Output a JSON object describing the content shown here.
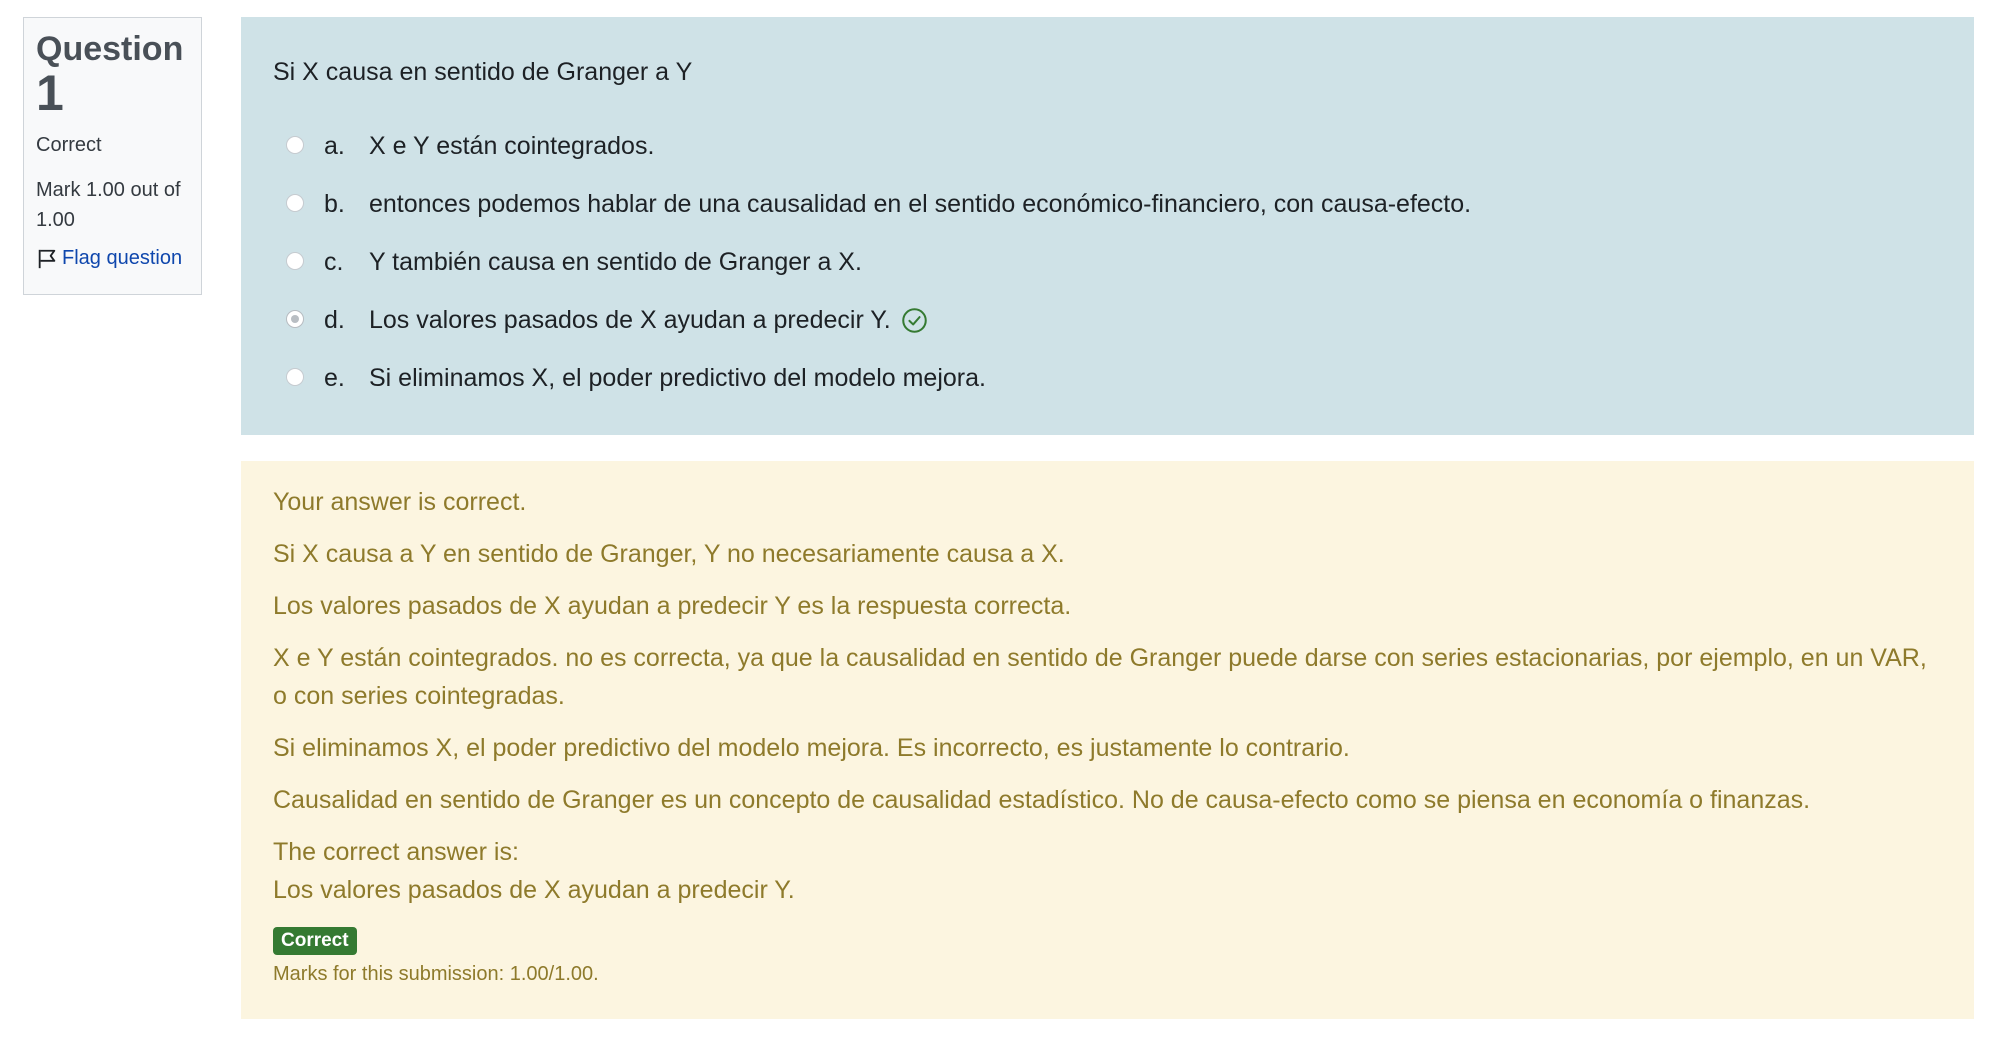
{
  "info": {
    "question_label": "Question",
    "question_number": "1",
    "state": "Correct",
    "grade": "Mark 1.00 out of 1.00",
    "flag_label": "Flag question"
  },
  "question": {
    "text": "Si X causa en sentido de Granger a Y",
    "answers": [
      {
        "letter": "a.",
        "text": "X e Y están cointegrados.",
        "selected": false
      },
      {
        "letter": "b.",
        "text": "entonces podemos hablar de una causalidad en el sentido económico-financiero, con causa-efecto.",
        "selected": false
      },
      {
        "letter": "c.",
        "text": "Y también causa en sentido de Granger a X.",
        "selected": false
      },
      {
        "letter": "d.",
        "text": "Los valores pasados de X ayudan a predecir Y.",
        "selected": true
      },
      {
        "letter": "e.",
        "text": "Si eliminamos X, el poder predictivo del modelo mejora.",
        "selected": false
      }
    ]
  },
  "feedback": {
    "paragraphs": [
      "Your answer is correct.",
      "Si X causa a Y en sentido de Granger, Y no necesariamente causa a X.",
      "Los valores pasados de X ayudan a predecir Y es la respuesta correcta.",
      "X e Y están cointegrados. no es correcta, ya que la causalidad en sentido de  Granger puede darse con series estacionarias, por ejemplo, en un VAR, o con series cointegradas.",
      "Si eliminamos X, el poder predictivo del modelo mejora. Es incorrecto, es justamente lo contrario.",
      "Causalidad en sentido de Granger es un concepto de causalidad estadístico. No de causa-efecto como se piensa en economía o finanzas."
    ],
    "right_answer_label": "The correct answer is:",
    "right_answer": "Los valores pasados de X ayudan a predecir Y.",
    "badge": "Correct",
    "marks": "Marks for this submission: 1.00/1.00."
  },
  "colors": {
    "content_bg": "#cfe2e7",
    "feedback_bg": "#fcf5e0",
    "feedback_text": "#8e7a2b",
    "badge_bg": "#357a32",
    "link": "#0f47ad",
    "correct_icon": "#357a32"
  },
  "icons": {
    "flag": "flag-icon",
    "correct": "check-circle-icon"
  }
}
